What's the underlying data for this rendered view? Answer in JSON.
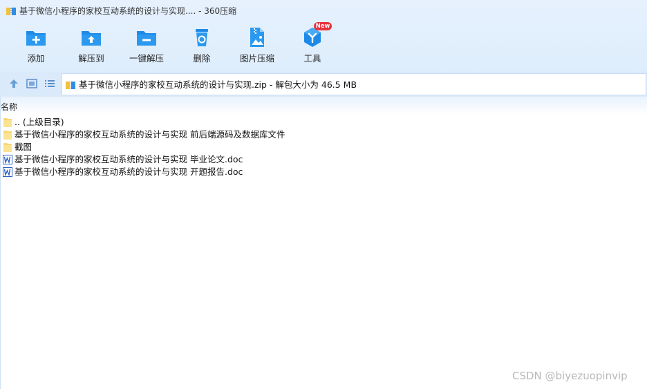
{
  "window": {
    "title": "基于微信小程序的家校互动系统的设计与实现.... - 360压缩",
    "app_icon": "zip-archive-icon"
  },
  "toolbar": {
    "items": [
      {
        "label": "添加",
        "icon": "add-folder-icon"
      },
      {
        "label": "解压到",
        "icon": "extract-to-icon"
      },
      {
        "label": "一键解压",
        "icon": "one-click-extract-icon"
      },
      {
        "label": "删除",
        "icon": "recycle-bin-icon"
      },
      {
        "label": "图片压缩",
        "icon": "image-compress-icon"
      },
      {
        "label": "工具",
        "icon": "tools-icon"
      }
    ],
    "new_badge": "New"
  },
  "navbar": {
    "up_icon": "up-arrow-icon",
    "view_icon": "thumbnail-view-icon",
    "list_icon": "list-view-icon",
    "path": "基于微信小程序的家校互动系统的设计与实现.zip - 解包大小为 46.5 MB"
  },
  "file_list": {
    "column_name": "名称",
    "rows": [
      {
        "name": ".. (上级目录)",
        "type": "folder"
      },
      {
        "name": "基于微信小程序的家校互动系统的设计与实现 前后端源码及数据库文件",
        "type": "folder"
      },
      {
        "name": "截图",
        "type": "folder"
      },
      {
        "name": "基于微信小程序的家校互动系统的设计与实现 毕业论文.doc",
        "type": "doc"
      },
      {
        "name": "基于微信小程序的家校互动系统的设计与实现 开题报告.doc",
        "type": "doc"
      }
    ]
  },
  "watermark": "CSDN @biyezuopinvip",
  "colors": {
    "accent_blue": "#1e8ae8",
    "folder_yellow": "#f7d774",
    "badge_red": "#e8313c"
  }
}
